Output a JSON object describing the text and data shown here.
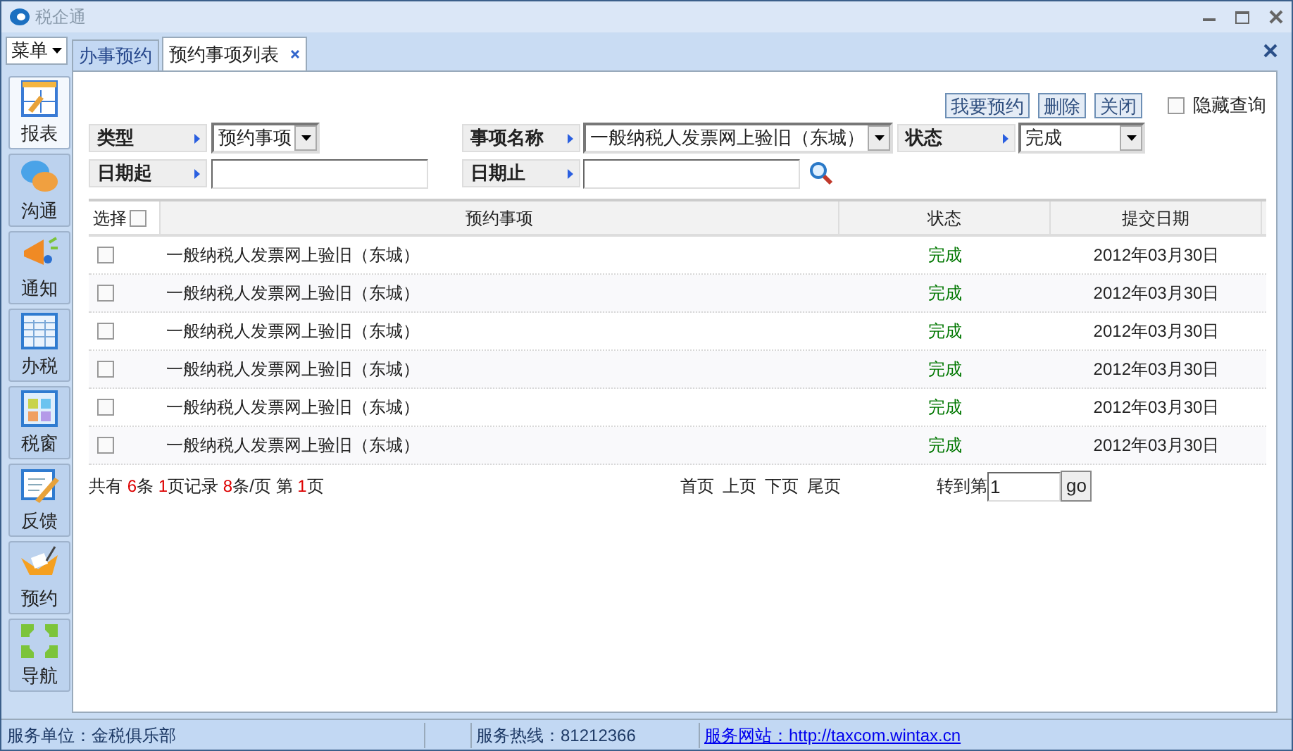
{
  "window": {
    "title": "税企通"
  },
  "menu_button": {
    "label": "菜单"
  },
  "sidebar": {
    "items": [
      {
        "label": "报表",
        "kind": "report",
        "selected": true
      },
      {
        "label": "沟通",
        "kind": "chat",
        "selected": false
      },
      {
        "label": "通知",
        "kind": "notice",
        "selected": false
      },
      {
        "label": "办税",
        "kind": "sheet",
        "selected": false
      },
      {
        "label": "税窗",
        "kind": "tiles",
        "selected": false
      },
      {
        "label": "反馈",
        "kind": "feedback",
        "selected": false
      },
      {
        "label": "预约",
        "kind": "booking",
        "selected": false
      },
      {
        "label": "导航",
        "kind": "nav",
        "selected": false
      }
    ]
  },
  "tabs": [
    {
      "label": "办事预约",
      "selected": false,
      "closable": false
    },
    {
      "label": "预约事项列表",
      "selected": true,
      "closable": true
    }
  ],
  "actions": {
    "buttons": [
      "我要预约",
      "删除",
      "关闭"
    ],
    "hide_query": {
      "label": "隐藏查询",
      "checked": false
    }
  },
  "filters": {
    "type": {
      "label": "类型",
      "value": "预约事项"
    },
    "item_name": {
      "label": "事项名称",
      "value": "一般纳税人发票网上验旧（东城）"
    },
    "status": {
      "label": "状态",
      "value": "完成"
    },
    "date_from": {
      "label": "日期起"
    },
    "date_to": {
      "label": "日期止"
    }
  },
  "table": {
    "select_all": {
      "label": "选择",
      "checked": false
    },
    "columns": [
      "预约事项",
      "状态",
      "提交日期"
    ],
    "rows": [
      {
        "checked": false,
        "item": "一般纳税人发票网上验旧（东城）",
        "status": "完成",
        "date": "2012年03月30日"
      },
      {
        "checked": false,
        "item": "一般纳税人发票网上验旧（东城）",
        "status": "完成",
        "date": "2012年03月30日"
      },
      {
        "checked": false,
        "item": "一般纳税人发票网上验旧（东城）",
        "status": "完成",
        "date": "2012年03月30日"
      },
      {
        "checked": false,
        "item": "一般纳税人发票网上验旧（东城）",
        "status": "完成",
        "date": "2012年03月30日"
      },
      {
        "checked": false,
        "item": "一般纳税人发票网上验旧（东城）",
        "status": "完成",
        "date": "2012年03月30日"
      },
      {
        "checked": false,
        "item": "一般纳税人发票网上验旧（东城）",
        "status": "完成",
        "date": "2012年03月30日"
      }
    ]
  },
  "pager": {
    "summary": [
      {
        "text": "共有 ",
        "kind": "label"
      },
      {
        "text": "6",
        "kind": "number"
      },
      {
        "text": "条 ",
        "kind": "label"
      },
      {
        "text": "1",
        "kind": "number"
      },
      {
        "text": "页记录 ",
        "kind": "label"
      },
      {
        "text": "8",
        "kind": "number"
      },
      {
        "text": "条/页 第 ",
        "kind": "label"
      },
      {
        "text": "1",
        "kind": "number"
      },
      {
        "text": "页",
        "kind": "label"
      }
    ],
    "links": [
      "首页",
      "上页",
      "下页",
      "尾页"
    ],
    "goto_label": "转到第",
    "goto_value": "1",
    "go_button": "go"
  },
  "status_bar": {
    "unit": "服务单位：金税俱乐部",
    "hotline": "服务热线：81212366",
    "website": "服务网站：http://taxcom.wintax.cn"
  }
}
